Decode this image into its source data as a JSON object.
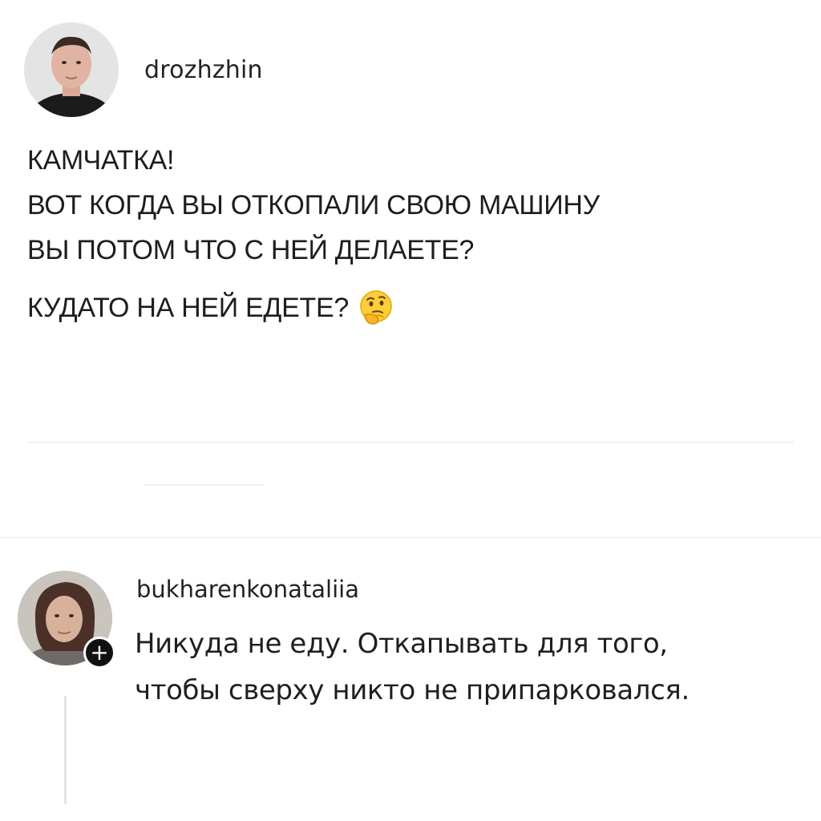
{
  "post": {
    "username": "drozhzhin",
    "lines": [
      "КАМЧАТКА!",
      "ВОТ КОГДА ВЫ ОТКОПАЛИ СВОЮ МАШИНУ",
      "ВЫ ПОТОМ ЧТО С НЕЙ ДЕЛАЕТЕ?"
    ],
    "last_line": "КУДАТО НА НЕЙ ЕДЕТЕ?",
    "emoji": "thinking-face-icon"
  },
  "comment": {
    "username": "bukharenkonataliia",
    "text_line_1": "Никуда не еду. Откапывать для того,",
    "text_line_2": "чтобы сверху никто не припарковался.",
    "badge_icon": "plus-icon",
    "badge_label": "+"
  }
}
